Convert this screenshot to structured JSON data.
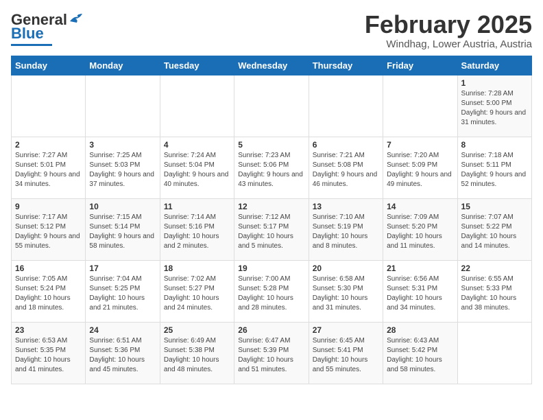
{
  "header": {
    "logo_general": "General",
    "logo_blue": "Blue",
    "month_title": "February 2025",
    "location": "Windhag, Lower Austria, Austria"
  },
  "days_of_week": [
    "Sunday",
    "Monday",
    "Tuesday",
    "Wednesday",
    "Thursday",
    "Friday",
    "Saturday"
  ],
  "weeks": [
    [
      {
        "day": "",
        "info": ""
      },
      {
        "day": "",
        "info": ""
      },
      {
        "day": "",
        "info": ""
      },
      {
        "day": "",
        "info": ""
      },
      {
        "day": "",
        "info": ""
      },
      {
        "day": "",
        "info": ""
      },
      {
        "day": "1",
        "info": "Sunrise: 7:28 AM\nSunset: 5:00 PM\nDaylight: 9 hours and 31 minutes."
      }
    ],
    [
      {
        "day": "2",
        "info": "Sunrise: 7:27 AM\nSunset: 5:01 PM\nDaylight: 9 hours and 34 minutes."
      },
      {
        "day": "3",
        "info": "Sunrise: 7:25 AM\nSunset: 5:03 PM\nDaylight: 9 hours and 37 minutes."
      },
      {
        "day": "4",
        "info": "Sunrise: 7:24 AM\nSunset: 5:04 PM\nDaylight: 9 hours and 40 minutes."
      },
      {
        "day": "5",
        "info": "Sunrise: 7:23 AM\nSunset: 5:06 PM\nDaylight: 9 hours and 43 minutes."
      },
      {
        "day": "6",
        "info": "Sunrise: 7:21 AM\nSunset: 5:08 PM\nDaylight: 9 hours and 46 minutes."
      },
      {
        "day": "7",
        "info": "Sunrise: 7:20 AM\nSunset: 5:09 PM\nDaylight: 9 hours and 49 minutes."
      },
      {
        "day": "8",
        "info": "Sunrise: 7:18 AM\nSunset: 5:11 PM\nDaylight: 9 hours and 52 minutes."
      }
    ],
    [
      {
        "day": "9",
        "info": "Sunrise: 7:17 AM\nSunset: 5:12 PM\nDaylight: 9 hours and 55 minutes."
      },
      {
        "day": "10",
        "info": "Sunrise: 7:15 AM\nSunset: 5:14 PM\nDaylight: 9 hours and 58 minutes."
      },
      {
        "day": "11",
        "info": "Sunrise: 7:14 AM\nSunset: 5:16 PM\nDaylight: 10 hours and 2 minutes."
      },
      {
        "day": "12",
        "info": "Sunrise: 7:12 AM\nSunset: 5:17 PM\nDaylight: 10 hours and 5 minutes."
      },
      {
        "day": "13",
        "info": "Sunrise: 7:10 AM\nSunset: 5:19 PM\nDaylight: 10 hours and 8 minutes."
      },
      {
        "day": "14",
        "info": "Sunrise: 7:09 AM\nSunset: 5:20 PM\nDaylight: 10 hours and 11 minutes."
      },
      {
        "day": "15",
        "info": "Sunrise: 7:07 AM\nSunset: 5:22 PM\nDaylight: 10 hours and 14 minutes."
      }
    ],
    [
      {
        "day": "16",
        "info": "Sunrise: 7:05 AM\nSunset: 5:24 PM\nDaylight: 10 hours and 18 minutes."
      },
      {
        "day": "17",
        "info": "Sunrise: 7:04 AM\nSunset: 5:25 PM\nDaylight: 10 hours and 21 minutes."
      },
      {
        "day": "18",
        "info": "Sunrise: 7:02 AM\nSunset: 5:27 PM\nDaylight: 10 hours and 24 minutes."
      },
      {
        "day": "19",
        "info": "Sunrise: 7:00 AM\nSunset: 5:28 PM\nDaylight: 10 hours and 28 minutes."
      },
      {
        "day": "20",
        "info": "Sunrise: 6:58 AM\nSunset: 5:30 PM\nDaylight: 10 hours and 31 minutes."
      },
      {
        "day": "21",
        "info": "Sunrise: 6:56 AM\nSunset: 5:31 PM\nDaylight: 10 hours and 34 minutes."
      },
      {
        "day": "22",
        "info": "Sunrise: 6:55 AM\nSunset: 5:33 PM\nDaylight: 10 hours and 38 minutes."
      }
    ],
    [
      {
        "day": "23",
        "info": "Sunrise: 6:53 AM\nSunset: 5:35 PM\nDaylight: 10 hours and 41 minutes."
      },
      {
        "day": "24",
        "info": "Sunrise: 6:51 AM\nSunset: 5:36 PM\nDaylight: 10 hours and 45 minutes."
      },
      {
        "day": "25",
        "info": "Sunrise: 6:49 AM\nSunset: 5:38 PM\nDaylight: 10 hours and 48 minutes."
      },
      {
        "day": "26",
        "info": "Sunrise: 6:47 AM\nSunset: 5:39 PM\nDaylight: 10 hours and 51 minutes."
      },
      {
        "day": "27",
        "info": "Sunrise: 6:45 AM\nSunset: 5:41 PM\nDaylight: 10 hours and 55 minutes."
      },
      {
        "day": "28",
        "info": "Sunrise: 6:43 AM\nSunset: 5:42 PM\nDaylight: 10 hours and 58 minutes."
      },
      {
        "day": "",
        "info": ""
      }
    ]
  ]
}
